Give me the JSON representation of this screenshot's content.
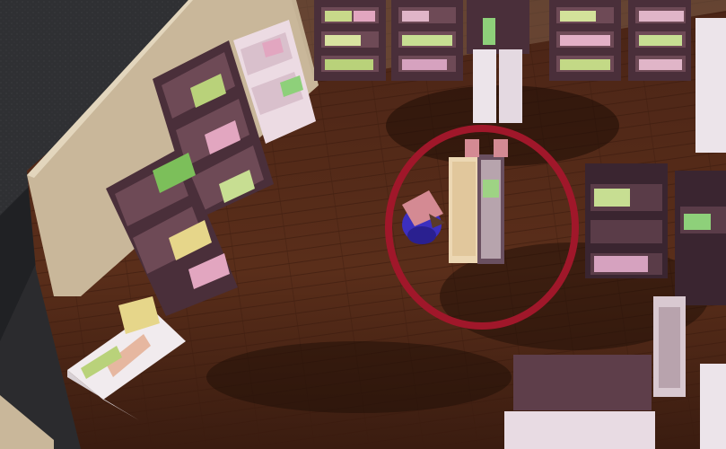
{
  "scene": {
    "type": "3d-library-game-view",
    "camera": "top-down-isometric",
    "player_highlight_ring_color": "#a0172a",
    "floor_color": "#5a2e1a",
    "wall_color": "#c8b79a",
    "outside_color": "#2f3033",
    "bookshelf_dark_color": "#4a2f3a",
    "bookshelf_light_color": "#e9d6dd",
    "player_color": "#3c2fbf",
    "player_hat_color": "#d48a93"
  }
}
